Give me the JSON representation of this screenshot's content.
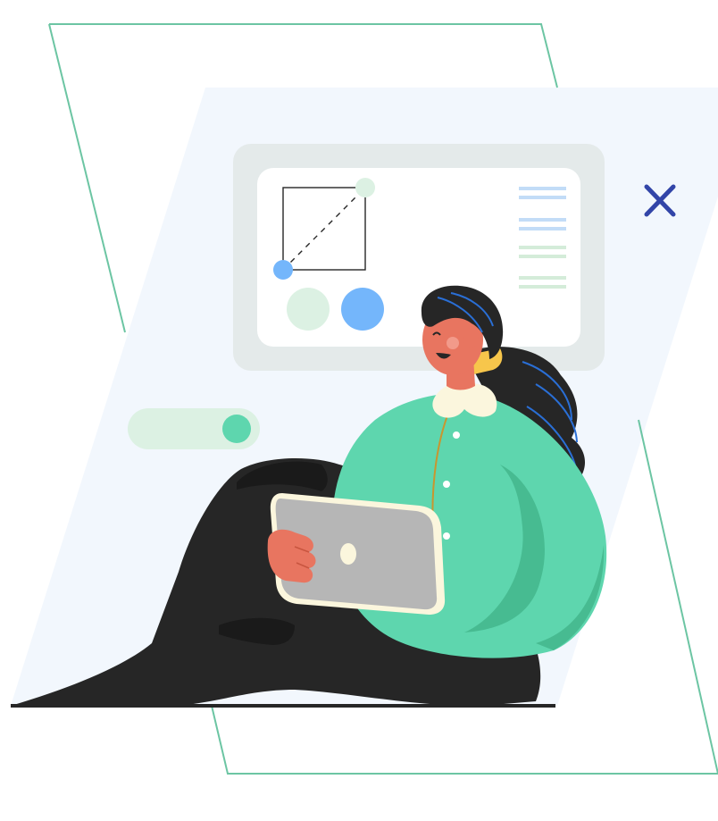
{
  "illustration": {
    "subject": "woman-with-tablet",
    "elements": {
      "frame": "parallelogram-outline",
      "backdrop": "parallelogram-panel",
      "screen": "ui-card-mockup",
      "toggle": "switch-on",
      "close": "close-icon"
    }
  },
  "toggle": {
    "state": "on"
  },
  "colors": {
    "backdrop": "#f2f7fd",
    "frame_line": "#6cc5a3",
    "card_outer": "#e4eaea",
    "card_inner": "#ffffff",
    "mint": "#5ed6ae",
    "mint_dark": "#47bb91",
    "mint_light": "#dcf1e3",
    "blue": "#74b6fb",
    "blue_line": "#c2dcf7",
    "green_line": "#d4ecd9",
    "close": "#3245a8",
    "ink": "#262626",
    "skin": "#e87560",
    "collar": "#fbf6dd",
    "scarf": "#f7c64b",
    "tablet": "#b6b6b6",
    "tablet_edge": "#fbf6dd"
  }
}
